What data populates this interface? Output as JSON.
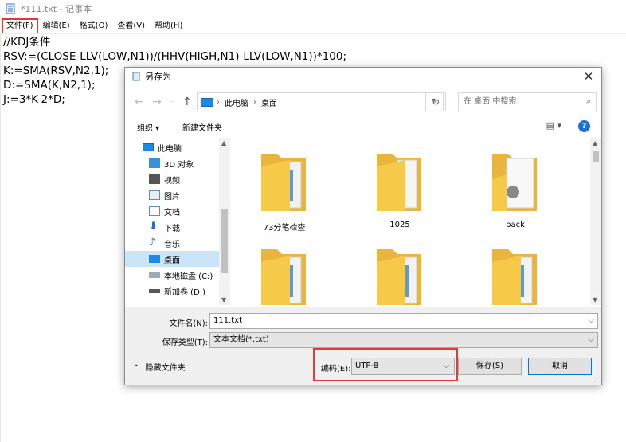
{
  "notepad": {
    "title": "*111.txt - 记事本",
    "menu": [
      "文件(F)",
      "编辑(E)",
      "格式(O)",
      "查看(V)",
      "帮助(H)"
    ],
    "content": "//KDJ条件\nRSV:=(CLOSE-LLV(LOW,N1))/(HHV(HIGH,N1)-LLV(LOW,N1))*100;\nK:=SMA(RSV,N2,1);\nD:=SMA(K,N2,1);\nJ:=3*K-2*D;"
  },
  "dialog": {
    "title": "另存为",
    "address": {
      "root": "此电脑",
      "current": "桌面"
    },
    "search_placeholder": "在 桌面 中搜索",
    "toolbar": {
      "organize": "组织 ▾",
      "new_folder": "新建文件夹"
    },
    "tree": [
      "此电脑",
      "3D 对象",
      "视频",
      "图片",
      "文档",
      "下载",
      "音乐",
      "桌面",
      "本地磁盘 (C:)",
      "新加卷 (D:)"
    ],
    "selected_tree_item": "桌面",
    "files": [
      "73分笔检查",
      "1025",
      "back"
    ],
    "filename_label": "文件名(N):",
    "filename_value": "111.txt",
    "savetype_label": "保存类型(T):",
    "savetype_value": "文本文档(*.txt)",
    "hide_folders": "隐藏文件夹",
    "encoding_label": "编码(E):",
    "encoding_value": "UTF-8",
    "save_button": "保存(S)",
    "cancel_button": "取消"
  },
  "colors": {
    "highlight_border": "#e53935",
    "accent": "#0078d7",
    "folder": "#f7c948"
  }
}
